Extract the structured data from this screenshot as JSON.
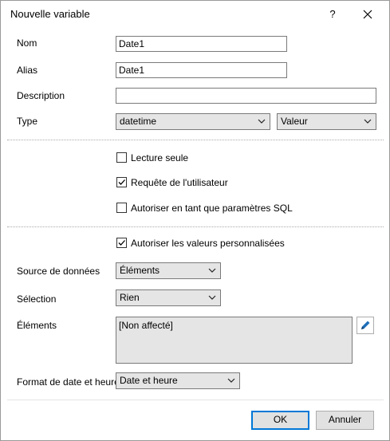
{
  "window": {
    "title": "Nouvelle variable",
    "help": "?"
  },
  "fields": {
    "nom": {
      "label": "Nom",
      "value": "Date1"
    },
    "alias": {
      "label": "Alias",
      "value": "Date1"
    },
    "description": {
      "label": "Description",
      "value": ""
    },
    "type": {
      "label": "Type",
      "value": "datetime",
      "kind": "Valeur"
    }
  },
  "checks": {
    "lecture_seule": {
      "label": "Lecture seule",
      "checked": false
    },
    "requete": {
      "label": "Requête de l'utilisateur",
      "checked": true
    },
    "sql": {
      "label": "Autoriser en tant que paramètres SQL",
      "checked": false
    },
    "custom": {
      "label": "Autoriser les valeurs personnalisées",
      "checked": true
    }
  },
  "source": {
    "label": "Source de données",
    "value": "Éléments"
  },
  "selection": {
    "label": "Sélection",
    "value": "Rien"
  },
  "elements": {
    "label": "Éléments",
    "items": [
      "[Non affecté]"
    ]
  },
  "format": {
    "label": "Format de date et heure",
    "value": "Date et heure"
  },
  "buttons": {
    "ok": "OK",
    "cancel": "Annuler"
  },
  "icons": {
    "close": "close-icon",
    "edit": "pencil-icon",
    "dropdown": "chevron-down-icon",
    "check": "checkmark-icon"
  },
  "colors": {
    "accent": "#0078d7"
  }
}
